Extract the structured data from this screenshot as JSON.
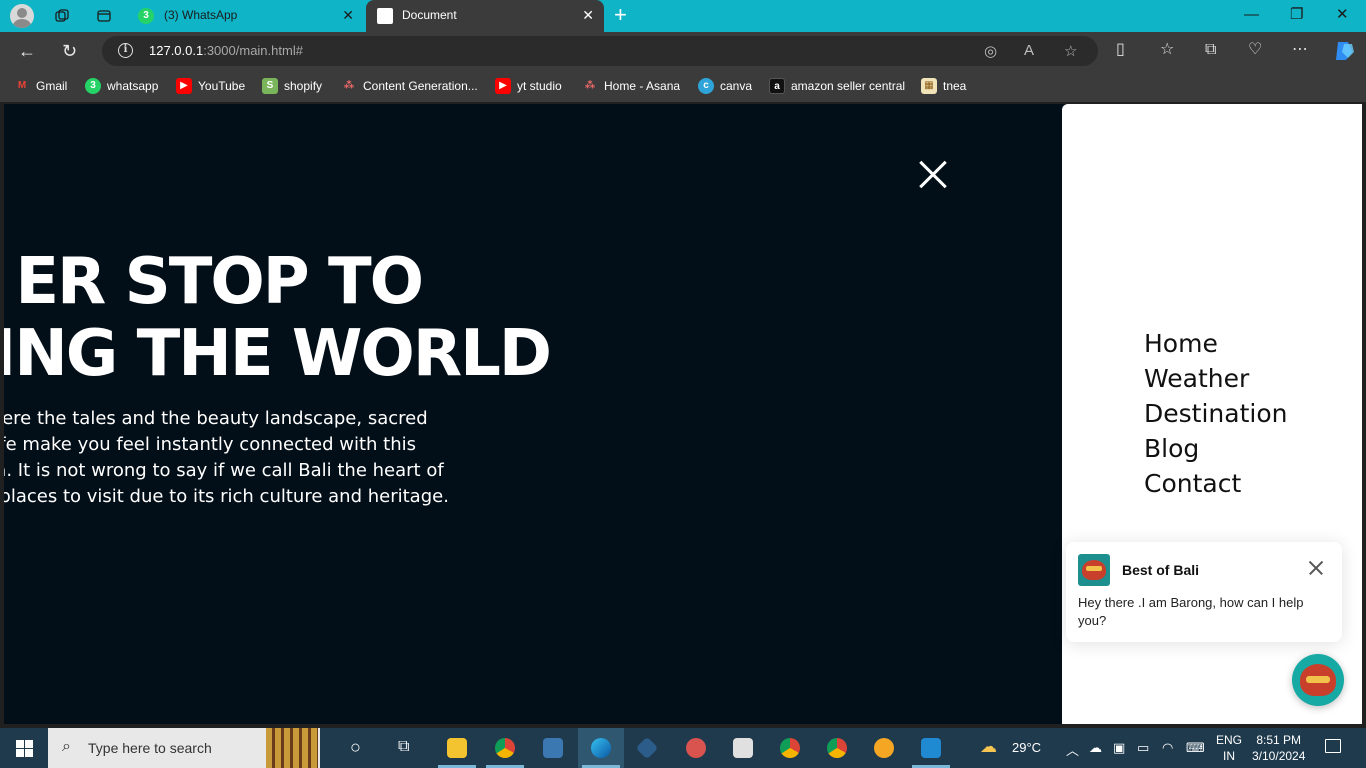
{
  "browser": {
    "tabs": [
      {
        "title": "(3) WhatsApp",
        "badge": "3"
      },
      {
        "title": "Document"
      }
    ],
    "url_host": "127.0.0.1",
    "url_rest": ":3000/main.html#",
    "bookmarks": [
      {
        "label": "Gmail",
        "icon": "gmail-icon"
      },
      {
        "label": "whatsapp",
        "icon": "whatsapp-icon",
        "badge": "3"
      },
      {
        "label": "YouTube",
        "icon": "youtube-icon"
      },
      {
        "label": "shopify",
        "icon": "shopify-icon"
      },
      {
        "label": "Content Generation...",
        "icon": "asana-icon"
      },
      {
        "label": "yt studio",
        "icon": "youtube-icon"
      },
      {
        "label": "Home - Asana",
        "icon": "asana-icon"
      },
      {
        "label": "canva",
        "icon": "canva-icon"
      },
      {
        "label": "amazon seller central",
        "icon": "amazon-icon"
      },
      {
        "label": "tnea",
        "icon": "tnea-icon"
      }
    ]
  },
  "page": {
    "headline_line1": "ER STOP TO",
    "headline_line2": "RING THE WORLD",
    "intro_lines": [
      "und where the tales and the beauty landscape, sacred",
      "g wildlife make you feel instantly connected with this",
      "donesia. It is not wrong to say if we call Bali the heart of",
      "he top places to visit due to its rich culture and heritage."
    ],
    "nav": [
      "Home",
      "Weather",
      "Destination",
      "Blog",
      "Contact"
    ],
    "chat": {
      "name": "Best of Bali",
      "message": "Hey there .I am Barong, how can I help you?"
    }
  },
  "taskbar": {
    "search_placeholder": "Type here to search",
    "weather": "29°C",
    "lang_line1": "ENG",
    "lang_line2": "IN",
    "time": "8:51 PM",
    "date": "3/10/2024"
  }
}
